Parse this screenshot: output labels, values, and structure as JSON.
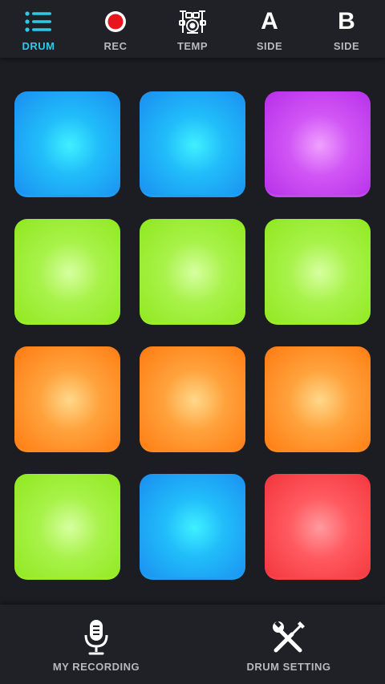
{
  "top_tabs": [
    {
      "label": "DRUM",
      "icon": "menu-list-icon",
      "active": true
    },
    {
      "label": "REC",
      "icon": "record-icon",
      "active": false
    },
    {
      "label": "TEMP",
      "icon": "drum-kit-icon",
      "active": false
    },
    {
      "label": "SIDE",
      "icon_text": "A",
      "active": false
    },
    {
      "label": "SIDE",
      "icon_text": "B",
      "active": false
    }
  ],
  "pads": [
    {
      "color": "blue"
    },
    {
      "color": "blue"
    },
    {
      "color": "purple"
    },
    {
      "color": "green"
    },
    {
      "color": "green"
    },
    {
      "color": "green"
    },
    {
      "color": "orange"
    },
    {
      "color": "orange"
    },
    {
      "color": "orange"
    },
    {
      "color": "green"
    },
    {
      "color": "blue"
    },
    {
      "color": "red"
    }
  ],
  "bottom_nav": [
    {
      "label": "MY RECORDING",
      "icon": "microphone-icon"
    },
    {
      "label": "DRUM SETTING",
      "icon": "tools-icon"
    }
  ],
  "colors": {
    "accent": "#2ec9e8",
    "record": "#e8141e",
    "background": "#1c1d22",
    "bar": "#202127"
  }
}
